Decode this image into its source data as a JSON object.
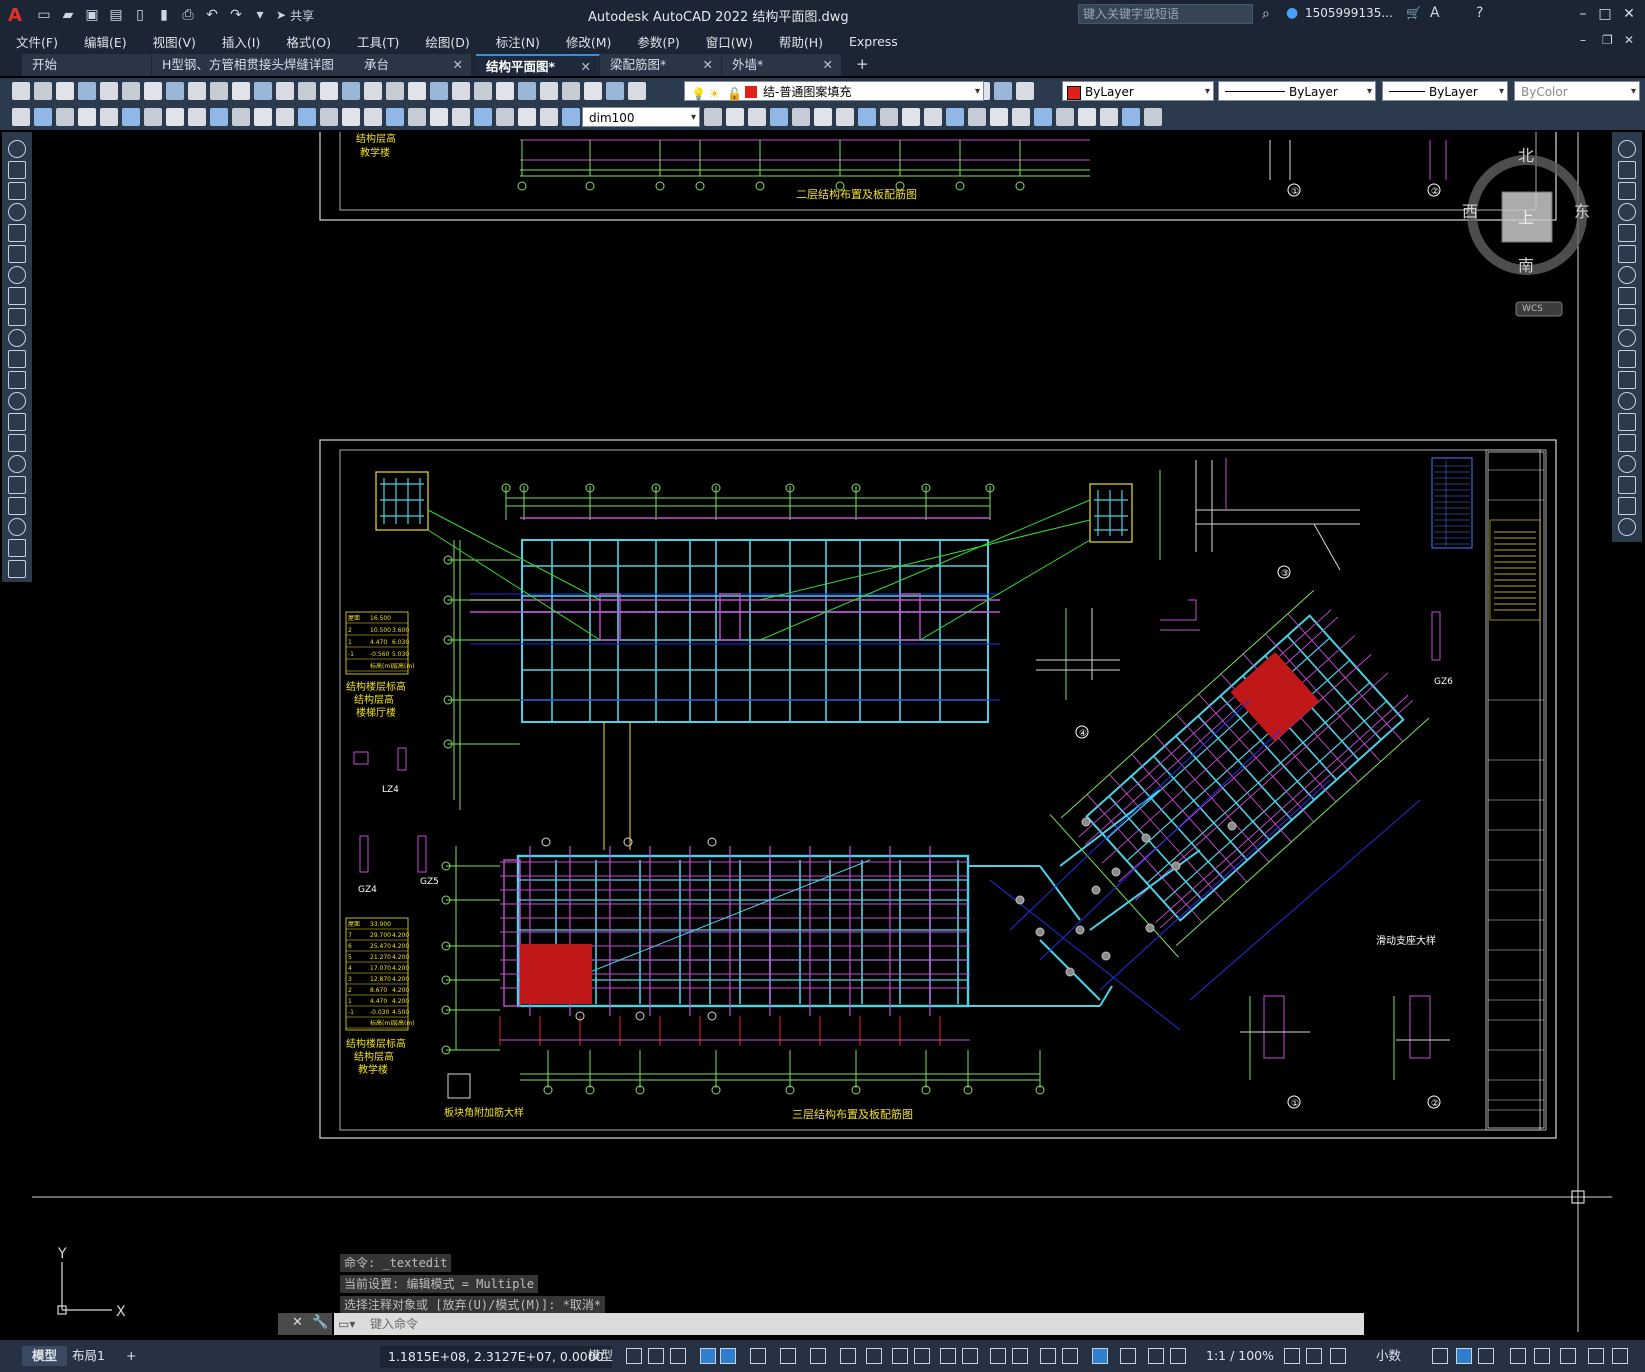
{
  "titlebar": {
    "app_logo": "A",
    "share_label": "共享",
    "title": "Autodesk AutoCAD 2022    结构平面图.dwg",
    "search_placeholder": "键入关键字或短语",
    "user": "1505999135...",
    "icons": [
      "new-icon",
      "open-icon",
      "save-icon",
      "saveas-icon",
      "web-open-icon",
      "web-save-icon",
      "plot-icon",
      "undo-icon",
      "redo-icon",
      "share-icon",
      "search-icon",
      "user-icon",
      "cart-icon",
      "autodesk-app-icon",
      "help-icon",
      "minimize-icon",
      "maximize-icon",
      "close-icon"
    ]
  },
  "menu": [
    "文件(F)",
    "编辑(E)",
    "视图(V)",
    "插入(I)",
    "格式(O)",
    "工具(T)",
    "绘图(D)",
    "标注(N)",
    "修改(M)",
    "参数(P)",
    "窗口(W)",
    "帮助(H)",
    "Express"
  ],
  "tabs": [
    {
      "label": "开始",
      "closable": false,
      "active": false
    },
    {
      "label": "H型钢、方管相贯接头焊缝详图",
      "closable": true,
      "active": false
    },
    {
      "label": "承台",
      "closable": true,
      "active": false
    },
    {
      "label": "结构平面图*",
      "closable": true,
      "active": true
    },
    {
      "label": "梁配筋图*",
      "closable": true,
      "active": false
    },
    {
      "label": "外墙*",
      "closable": true,
      "active": false
    }
  ],
  "tab_add": "+",
  "properties": {
    "layer": "结-普通图案填充",
    "color": "ByLayer",
    "linetype": "ByLayer",
    "lineweight": "ByLayer",
    "plotstyle": "ByColor",
    "dimstyle": "dim100",
    "layer_color": "#e0201b",
    "color_swatch": "#e0201b"
  },
  "viewcube": {
    "north": "北",
    "south": "南",
    "east": "东",
    "west": "西",
    "top": "上",
    "wcs": "WCS"
  },
  "ucs": {
    "x": "X",
    "y": "Y"
  },
  "drawing": {
    "plan_title_top": "二层结构布置及板配筋图",
    "plan_title_bottom": "三层结构布置及板配筋图",
    "note_bottom_left": "板块角附加筋大样",
    "note_right": "滑动支座大样",
    "label_lz4": "LZ4",
    "label_gz4": "GZ4",
    "label_gz5": "GZ5",
    "label_gz6": "GZ6",
    "table_top_title": "结构楼层标高",
    "table_top_sub": "结构层高",
    "table_top_tag": "楼梯厅楼",
    "table_bottom_title": "结构楼层标高",
    "table_bottom_sub": "结构层高",
    "table_bottom_tag": "教学楼",
    "top_left_sub": "结构层高",
    "top_left_tag": "教学楼",
    "detail_marks": [
      "①",
      "②",
      "③",
      "④"
    ],
    "table_top_rows": [
      [
        "屋面",
        "16.500",
        ""
      ],
      [
        "2",
        "10.500",
        "3.600"
      ],
      [
        "1",
        "4.470",
        "6.030"
      ],
      [
        "-1",
        "-0.560",
        "5.030"
      ],
      [
        "",
        "标高(m)",
        "层高(m)"
      ]
    ],
    "table_bottom_rows": [
      [
        "屋面",
        "33.900",
        ""
      ],
      [
        "7",
        "29.700",
        "4.200"
      ],
      [
        "6",
        "25.470",
        "4.200"
      ],
      [
        "5",
        "21.270",
        "4.200"
      ],
      [
        "4",
        "17.070",
        "4.200"
      ],
      [
        "3",
        "12.870",
        "4.200"
      ],
      [
        "2",
        "8.670",
        "4.200"
      ],
      [
        "1",
        "4.470",
        "4.200"
      ],
      [
        "-1",
        "-0.030",
        "4.500"
      ],
      [
        "",
        "标高(m)",
        "层高(m)"
      ]
    ]
  },
  "command": {
    "history": [
      "命令: _textedit",
      "当前设置: 编辑模式 = Multiple",
      "选择注释对象或 [放弃(U)/模式(M)]: *取消*"
    ],
    "placeholder": "键入命令"
  },
  "status": {
    "model_tab": "模型",
    "layout_tab": "布局1",
    "add": "+",
    "coordinates": "1.1815E+08, 2.3127E+07, 0.0000",
    "space": "模型",
    "scale": "1:1 / 100%",
    "units": "小数"
  }
}
